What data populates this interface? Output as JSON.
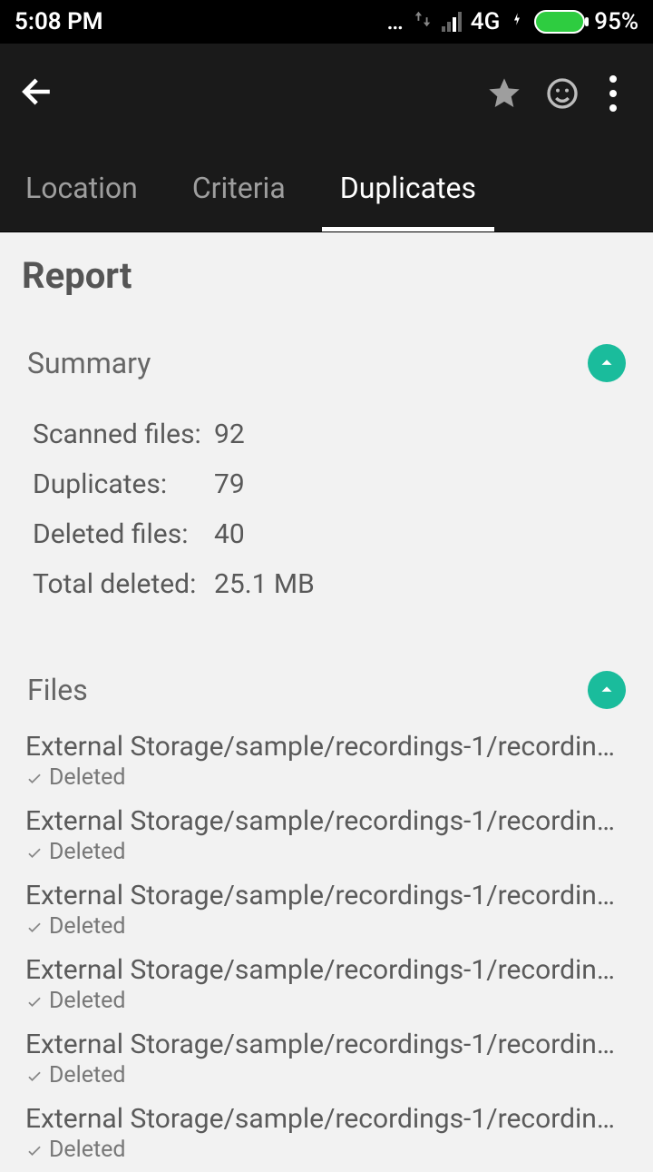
{
  "status": {
    "time": "5:08 PM",
    "network": "4G",
    "battery_pct": "95%"
  },
  "appbar": {
    "icons": {
      "star": "star-icon",
      "smiley": "smiley-icon",
      "more": "more-icon"
    }
  },
  "tabs": [
    "Location",
    "Criteria",
    "Duplicates"
  ],
  "active_tab": 2,
  "report": {
    "title": "Report",
    "summary_title": "Summary",
    "rows": [
      {
        "label": "Scanned files:",
        "value": "92"
      },
      {
        "label": "Duplicates:",
        "value": "79"
      },
      {
        "label": "Deleted files:",
        "value": "40"
      },
      {
        "label": "Total deleted:",
        "value": "25.1 MB"
      }
    ],
    "files_title": "Files",
    "files": [
      {
        "path": "External Storage/sample/recordings-1/recording-…",
        "status": "Deleted"
      },
      {
        "path": "External Storage/sample/recordings-1/recording-…",
        "status": "Deleted"
      },
      {
        "path": "External Storage/sample/recordings-1/recording-…",
        "status": "Deleted"
      },
      {
        "path": "External Storage/sample/recordings-1/recording-…",
        "status": "Deleted"
      },
      {
        "path": "External Storage/sample/recordings-1/recording-…",
        "status": "Deleted"
      },
      {
        "path": "External Storage/sample/recordings-1/recording-…",
        "status": "Deleted"
      }
    ]
  }
}
